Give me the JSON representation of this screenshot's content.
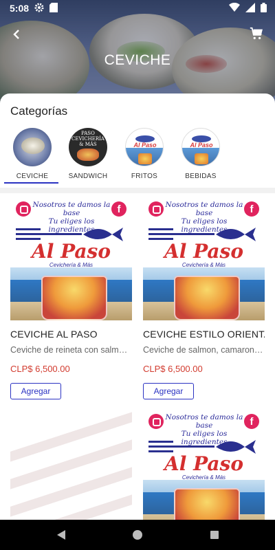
{
  "status_bar": {
    "time": "5:08"
  },
  "header": {
    "title": "CEVICHE"
  },
  "categories": {
    "title": "Categorías",
    "items": [
      {
        "label": "CEVICHE",
        "selected": true
      },
      {
        "label": "SANDWICH",
        "selected": false,
        "image_text": "PASO CEVICHERÍA & MÁS"
      },
      {
        "label": "FRITOS",
        "selected": false,
        "image_text": "Al Paso"
      },
      {
        "label": "BEBIDAS",
        "selected": false,
        "image_text": "Al Paso"
      }
    ]
  },
  "promo": {
    "slogan_line1": "Nosotros te damos la base",
    "slogan_line2": "Tu eliges los ingredientes",
    "brand": "Al Paso",
    "sub": "Cevichería & Más",
    "fb": "f"
  },
  "products": [
    {
      "name": "CEVICHE AL PASO",
      "description": "Ceviche de reineta con salmon...",
      "price": "CLP$ 6,500.00",
      "button": "Agregar"
    },
    {
      "name": "CEVICHE ESTILO ORIENTAL",
      "description": "Ceviche de salmon, camaron y...",
      "price": "CLP$ 6,500.00",
      "button": "Agregar"
    }
  ],
  "colors": {
    "accent": "#2a32c2",
    "price": "#d23b2f"
  }
}
